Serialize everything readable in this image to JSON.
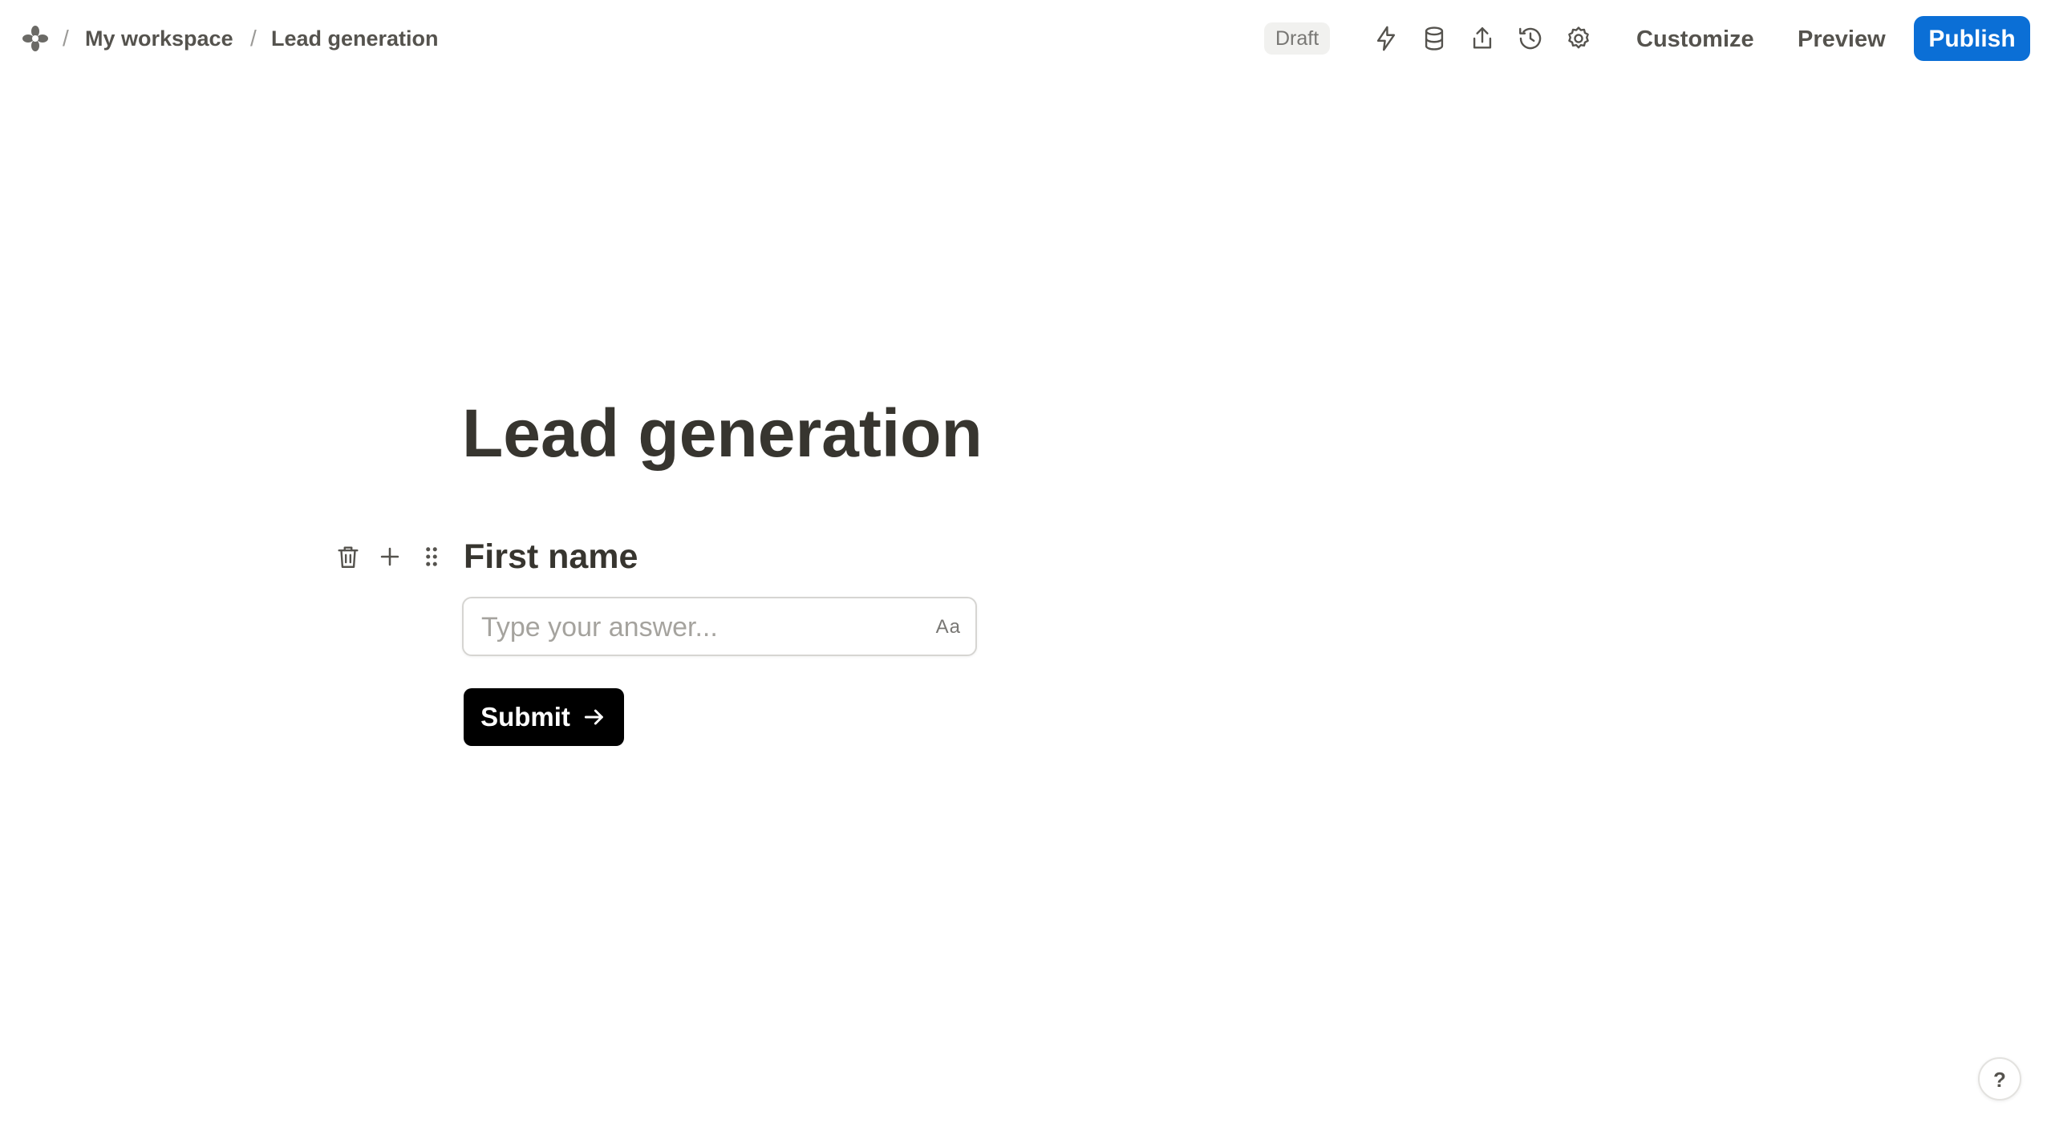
{
  "breadcrumb": {
    "separator": "/",
    "workspace": "My workspace",
    "page": "Lead generation"
  },
  "status": {
    "badge": "Draft"
  },
  "toolbar": {
    "icons": [
      "lightning-icon",
      "database-icon",
      "share-icon",
      "history-icon",
      "settings-icon"
    ],
    "customize_label": "Customize",
    "preview_label": "Preview",
    "publish_label": "Publish",
    "publish_color": "#0b6fd6"
  },
  "form": {
    "title": "Lead generation",
    "question": {
      "label": "First name",
      "placeholder": "Type your answer...",
      "value": "",
      "type_toggle": "Aa"
    },
    "block_tools": [
      "trash-icon",
      "plus-icon",
      "drag-handle-icon"
    ],
    "submit_label": "Submit"
  },
  "help": {
    "label": "?"
  }
}
